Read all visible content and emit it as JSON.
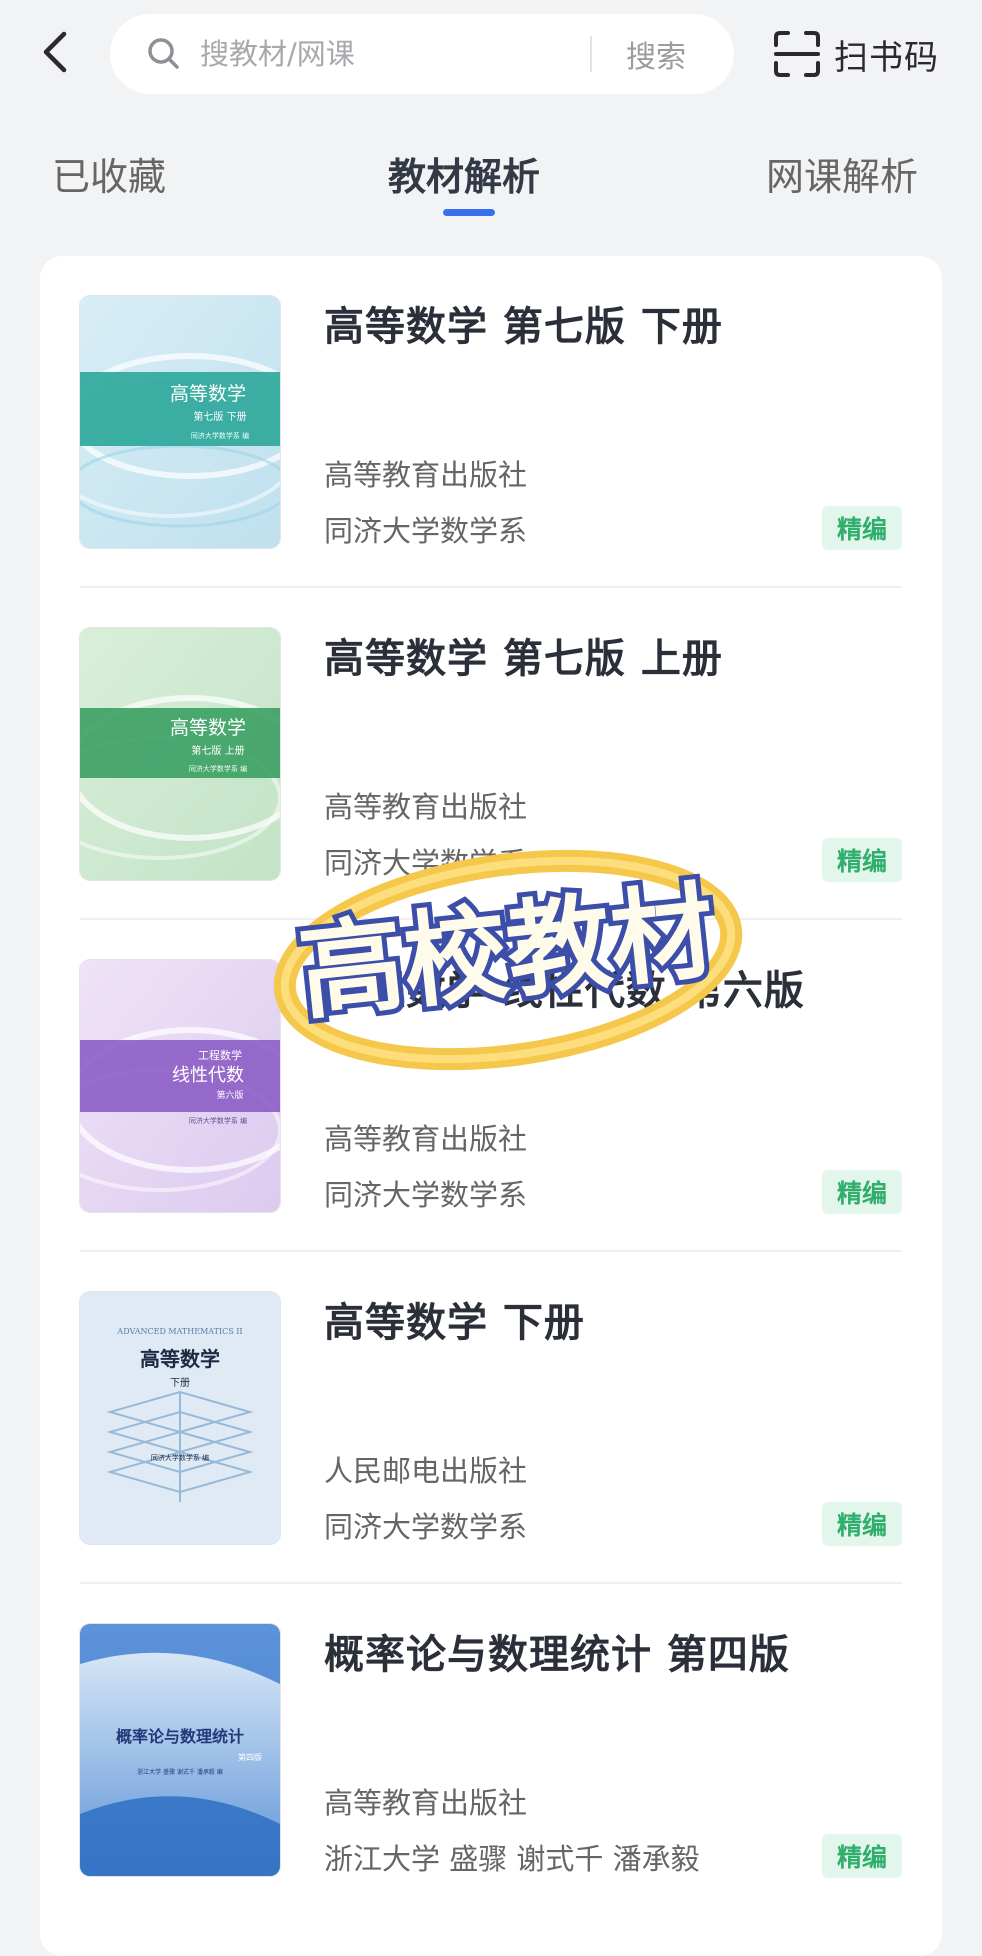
{
  "header": {
    "back_icon": "chevron-left-icon",
    "search": {
      "placeholder": "搜教材/网课",
      "button_label": "搜索",
      "icon": "search-icon"
    },
    "scan": {
      "label": "扫书码",
      "icon": "scan-icon"
    }
  },
  "tabs": [
    {
      "label": "已收藏",
      "active": false
    },
    {
      "label": "教材解析",
      "active": true
    },
    {
      "label": "网课解析",
      "active": false
    }
  ],
  "accent_color": "#3670ef",
  "badge_color": "#2fae6c",
  "books": [
    {
      "title": "高等数学 第七版 下册",
      "publisher": "高等教育出版社",
      "author": "同济大学数学系",
      "badge": "精编",
      "cover": {
        "title": "高等数学",
        "subtitle": "第七版 下册",
        "author": "同济大学数学系 编",
        "band_color": "#2fa89c"
      }
    },
    {
      "title": "高等数学 第七版 上册",
      "publisher": "高等教育出版社",
      "author": "同济大学数学系",
      "badge": "精编",
      "cover": {
        "title": "高等数学",
        "subtitle": "第七版 上册",
        "author": "同济大学数学系 编",
        "band_color": "#3ea266"
      }
    },
    {
      "title": "工程数学 线性代数 第六版",
      "publisher": "高等教育出版社",
      "author": "同济大学数学系",
      "badge": "精编",
      "cover": {
        "title": "线性代数",
        "pretitle": "工程数学",
        "subtitle": "第六版",
        "author": "同济大学数学系 编",
        "band_color": "#8a5ac4"
      }
    },
    {
      "title": "高等数学 下册",
      "publisher": "人民邮电出版社",
      "author": "同济大学数学系",
      "badge": "精编",
      "cover": {
        "title": "高等数学",
        "pretitle": "ADVANCED MATHEMATICS II",
        "subtitle": "下册",
        "author": "同济大学数学系 编"
      }
    },
    {
      "title": "概率论与数理统计 第四版",
      "publisher": "高等教育出版社",
      "author": "浙江大学 盛骤 谢式千 潘承毅",
      "badge": "精编",
      "cover": {
        "title": "概率论与数理统计",
        "subtitle": "第四版",
        "author": "浙江大学 盛骤 谢式千 潘承毅 编"
      }
    }
  ],
  "watermark": {
    "text": "高校教材"
  }
}
